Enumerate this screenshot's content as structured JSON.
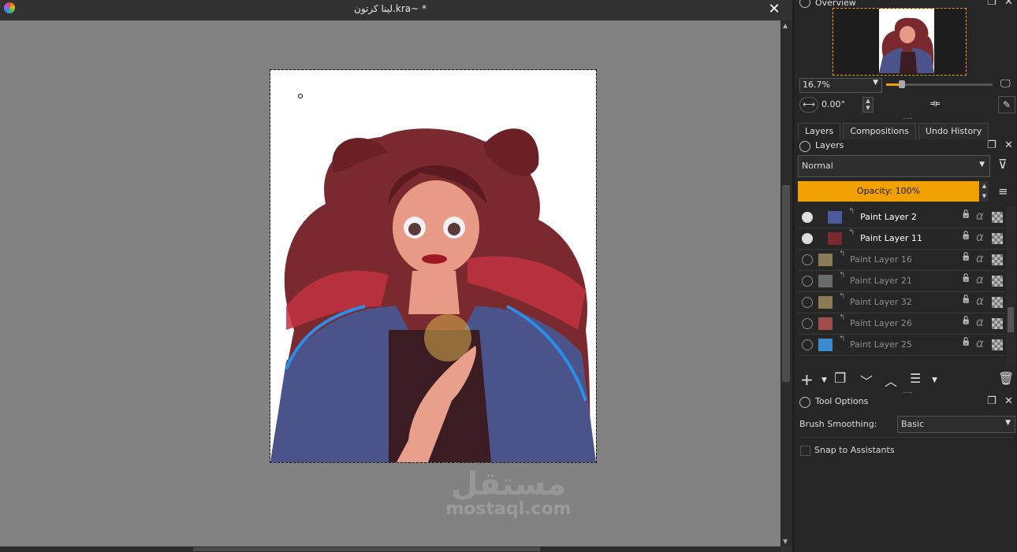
{
  "window": {
    "title": "لينا كرتون.kra~ *",
    "close_glyph": "✕"
  },
  "canvas": {
    "watermark_arabic": "مستقل",
    "watermark_english": "mostaql.com"
  },
  "overview": {
    "title": "Overview",
    "zoom_value": "16.7%",
    "rotation_value": "0.00°",
    "zoom_slider_level": 0.12
  },
  "tabs": [
    {
      "label": "Layers",
      "active": true
    },
    {
      "label": "Compositions",
      "active": false
    },
    {
      "label": "Undo History",
      "active": false
    }
  ],
  "layers_docker": {
    "title": "Layers",
    "blend_mode": "Normal",
    "opacity_label": "Opacity:  100%",
    "layers": [
      {
        "name": "Paint Layer 2",
        "visible": true
      },
      {
        "name": "Paint Layer 11",
        "visible": true
      },
      {
        "name": "Paint Layer 16",
        "visible": false
      },
      {
        "name": "Paint Layer 21",
        "visible": false
      },
      {
        "name": "Paint Layer 32",
        "visible": false
      },
      {
        "name": "Paint Layer 26",
        "visible": false
      },
      {
        "name": "Paint Layer 25",
        "visible": false
      }
    ]
  },
  "tool_options": {
    "title": "Tool Options",
    "brush_smoothing_label": "Brush Smoothing:",
    "brush_smoothing_value": "Basic",
    "snap_label": "Snap to Assistants"
  },
  "colors": {
    "accent": "#f0a000",
    "canvas_bg": "#828282",
    "panel_bg": "#262626"
  }
}
